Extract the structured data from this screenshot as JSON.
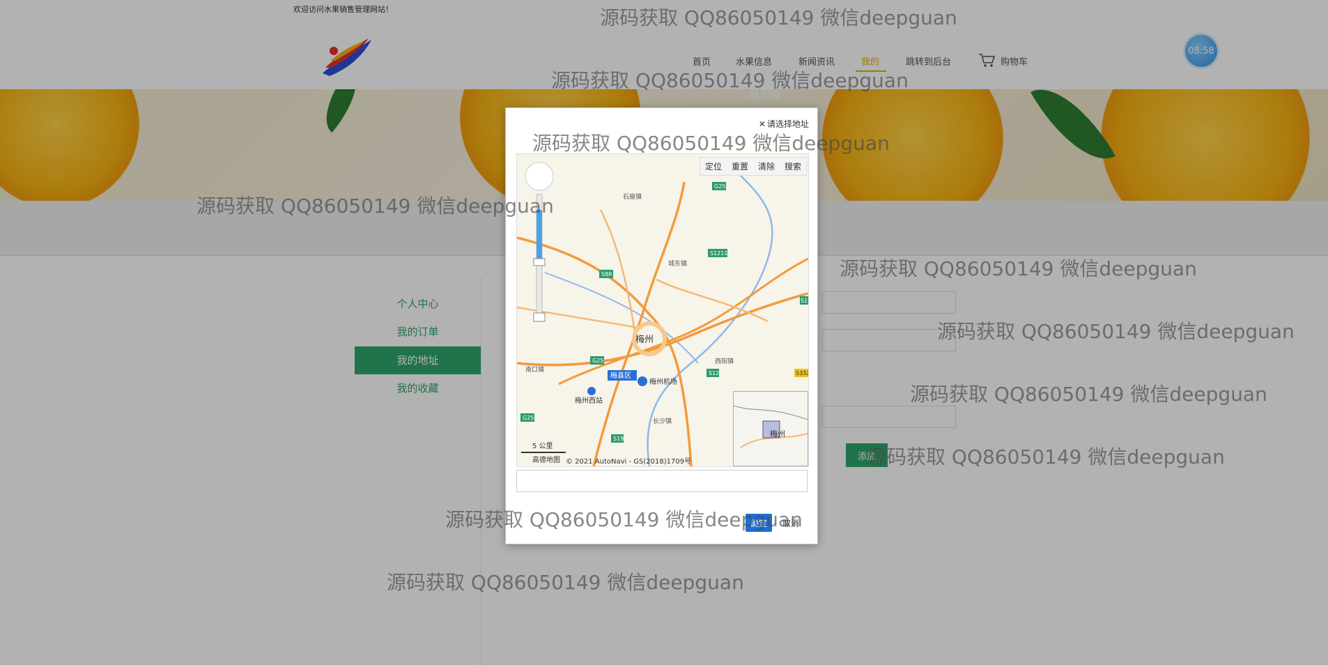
{
  "topbar": {
    "welcome": "欢迎访问水果销售管理网站！"
  },
  "nav": {
    "items": [
      "首页",
      "水果信息",
      "新闻资讯",
      "我的",
      "跳转到后台"
    ],
    "active": "我的",
    "cart_label": "购物车"
  },
  "clock": {
    "time": "08:58"
  },
  "banner": {
    "percent": "87%"
  },
  "sidebar": {
    "items": [
      {
        "label": "个人中心"
      },
      {
        "label": "我的订单"
      },
      {
        "label": "我的地址"
      },
      {
        "label": "我的收藏"
      }
    ],
    "active": "我的地址"
  },
  "form": {
    "add_label": "添加"
  },
  "modal": {
    "close_label": "请选择地址",
    "toolbar": [
      "定位",
      "重置",
      "清除",
      "搜索"
    ],
    "address_value": "",
    "ok_label": "确定",
    "cancel_label": "取消"
  },
  "map": {
    "labels": {
      "city": "梅州",
      "district": "梅县区",
      "airport": "梅州机场",
      "station": "梅州西站",
      "town1": "石扇镇",
      "town2": "城东镇",
      "town3": "南口镇",
      "town4": "西阳镇",
      "town5": "长沙镇",
      "minimap_city": "梅州"
    },
    "roads": [
      "G25",
      "S1211",
      "S88",
      "G25",
      "S12",
      "S19",
      "G25",
      "S332",
      "S1"
    ],
    "scale": "5 公里",
    "provider": "高德地图",
    "copyright": "© 2021 AutoNavi - GS(2018)1709号"
  },
  "watermark": "源码获取 QQ86050149 微信deepguan"
}
